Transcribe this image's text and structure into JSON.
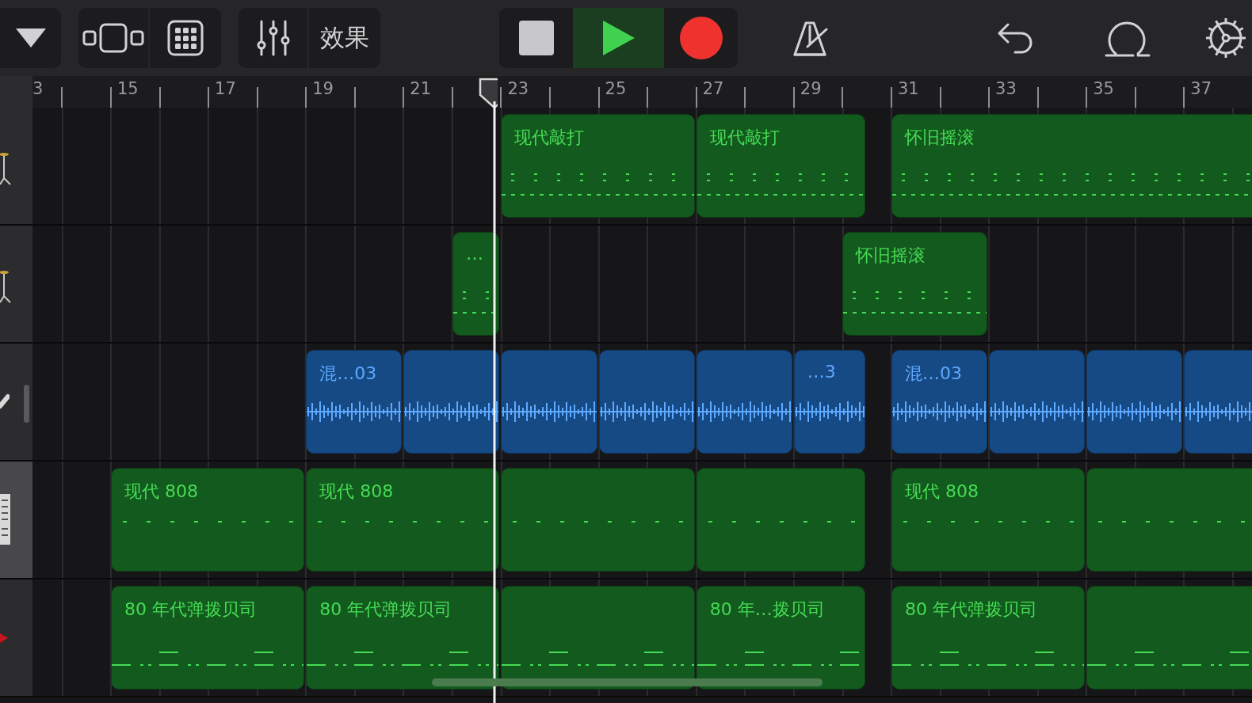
{
  "toolbar": {
    "effects_button": "效果"
  },
  "transport": {
    "playing": true,
    "recording": false
  },
  "ruler": {
    "bar_labels": [
      "3",
      "15",
      "17",
      "19",
      "21",
      "23",
      "25",
      "27",
      "29",
      "31",
      "33",
      "35",
      "37"
    ]
  },
  "tracks": [
    {
      "kind": "drums",
      "selected": false,
      "regions": [
        {
          "kind": "midi",
          "label": "现代敲打"
        },
        {
          "kind": "midi",
          "label": "现代敲打"
        },
        {
          "kind": "midi",
          "label": "怀旧摇滚"
        }
      ]
    },
    {
      "kind": "drums",
      "selected": false,
      "regions": [
        {
          "kind": "midi",
          "label": "…"
        },
        {
          "kind": "midi",
          "label": "怀旧摇滚"
        }
      ]
    },
    {
      "kind": "audio",
      "selected": false,
      "regions": [
        {
          "kind": "audio",
          "label": "混…03"
        },
        {
          "kind": "audio"
        },
        {
          "kind": "audio"
        },
        {
          "kind": "audio"
        },
        {
          "kind": "audio"
        },
        {
          "kind": "audio",
          "label": "…3"
        },
        {
          "kind": "audio",
          "label": "混…03"
        },
        {
          "kind": "audio"
        },
        {
          "kind": "audio"
        },
        {
          "kind": "audio"
        }
      ]
    },
    {
      "kind": "drum-machine",
      "selected": true,
      "regions": [
        {
          "kind": "midi",
          "label": "现代 808"
        },
        {
          "kind": "midi",
          "label": "现代 808"
        },
        {
          "kind": "midi"
        },
        {
          "kind": "midi"
        },
        {
          "kind": "midi",
          "label": "现代 808"
        },
        {
          "kind": "midi"
        }
      ]
    },
    {
      "kind": "bass",
      "selected": false,
      "regions": [
        {
          "kind": "midi",
          "label": "80 年代弹拨贝司"
        },
        {
          "kind": "midi",
          "label": "80 年代弹拨贝司"
        },
        {
          "kind": "midi"
        },
        {
          "kind": "midi",
          "label": "80 年…拨贝司"
        },
        {
          "kind": "midi",
          "label": "80 年代弹拨贝司"
        },
        {
          "kind": "midi"
        }
      ]
    }
  ]
}
